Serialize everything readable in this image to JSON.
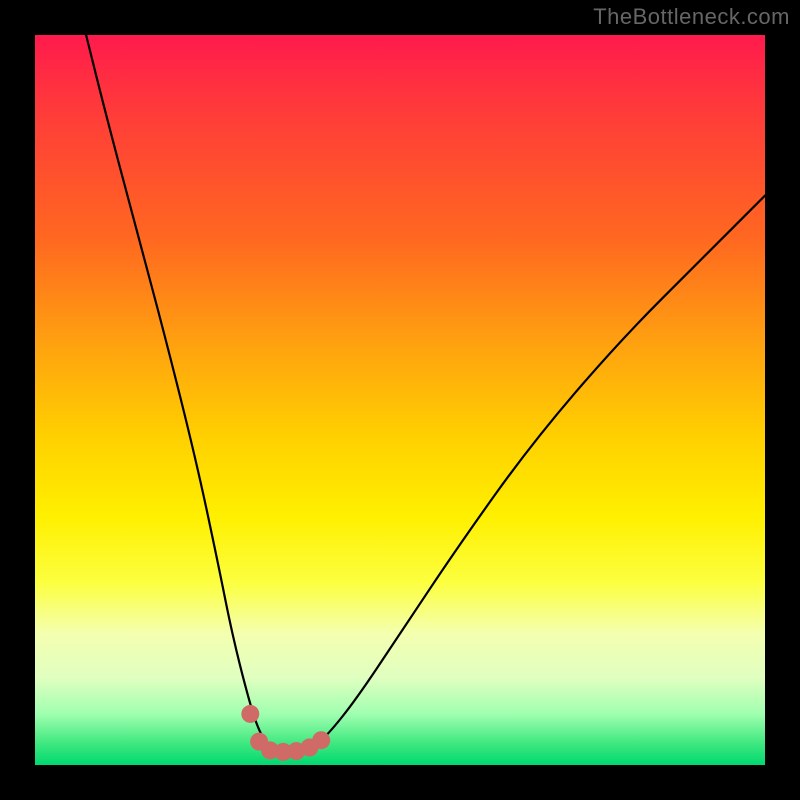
{
  "watermark": "TheBottleneck.com",
  "chart_data": {
    "type": "line",
    "title": "",
    "xlabel": "",
    "ylabel": "",
    "xlim": [
      0,
      100
    ],
    "ylim": [
      0,
      100
    ],
    "gradient_stops": [
      {
        "pos": 0,
        "color": "#ff1a4d"
      },
      {
        "pos": 10,
        "color": "#ff3a3a"
      },
      {
        "pos": 28,
        "color": "#ff6820"
      },
      {
        "pos": 42,
        "color": "#ffa010"
      },
      {
        "pos": 55,
        "color": "#ffd000"
      },
      {
        "pos": 66,
        "color": "#fff000"
      },
      {
        "pos": 75,
        "color": "#fcff40"
      },
      {
        "pos": 82,
        "color": "#f4ffb0"
      },
      {
        "pos": 88,
        "color": "#e0ffc0"
      },
      {
        "pos": 93,
        "color": "#a0ffb0"
      },
      {
        "pos": 97,
        "color": "#40e880"
      },
      {
        "pos": 100,
        "color": "#00d870"
      }
    ],
    "series": [
      {
        "name": "bottleneck-curve",
        "color": "#000000",
        "x": [
          7,
          10,
          14,
          18,
          22,
          25,
          27,
          29,
          30.5,
          32,
          34,
          36,
          38,
          40,
          44,
          50,
          58,
          68,
          80,
          92,
          100
        ],
        "y": [
          100,
          88,
          73,
          58,
          42,
          28,
          18,
          10,
          5,
          2.5,
          2,
          2,
          2.5,
          4,
          9,
          18,
          30,
          44,
          58,
          70,
          78
        ]
      }
    ],
    "markers": {
      "name": "highlight-dots",
      "color": "#cf6a66",
      "radius": 9,
      "points": [
        {
          "x": 29.5,
          "y": 7
        },
        {
          "x": 30.7,
          "y": 3.2
        },
        {
          "x": 32.2,
          "y": 2.0
        },
        {
          "x": 34.0,
          "y": 1.8
        },
        {
          "x": 35.8,
          "y": 1.9
        },
        {
          "x": 37.6,
          "y": 2.4
        },
        {
          "x": 39.2,
          "y": 3.4
        }
      ]
    }
  }
}
